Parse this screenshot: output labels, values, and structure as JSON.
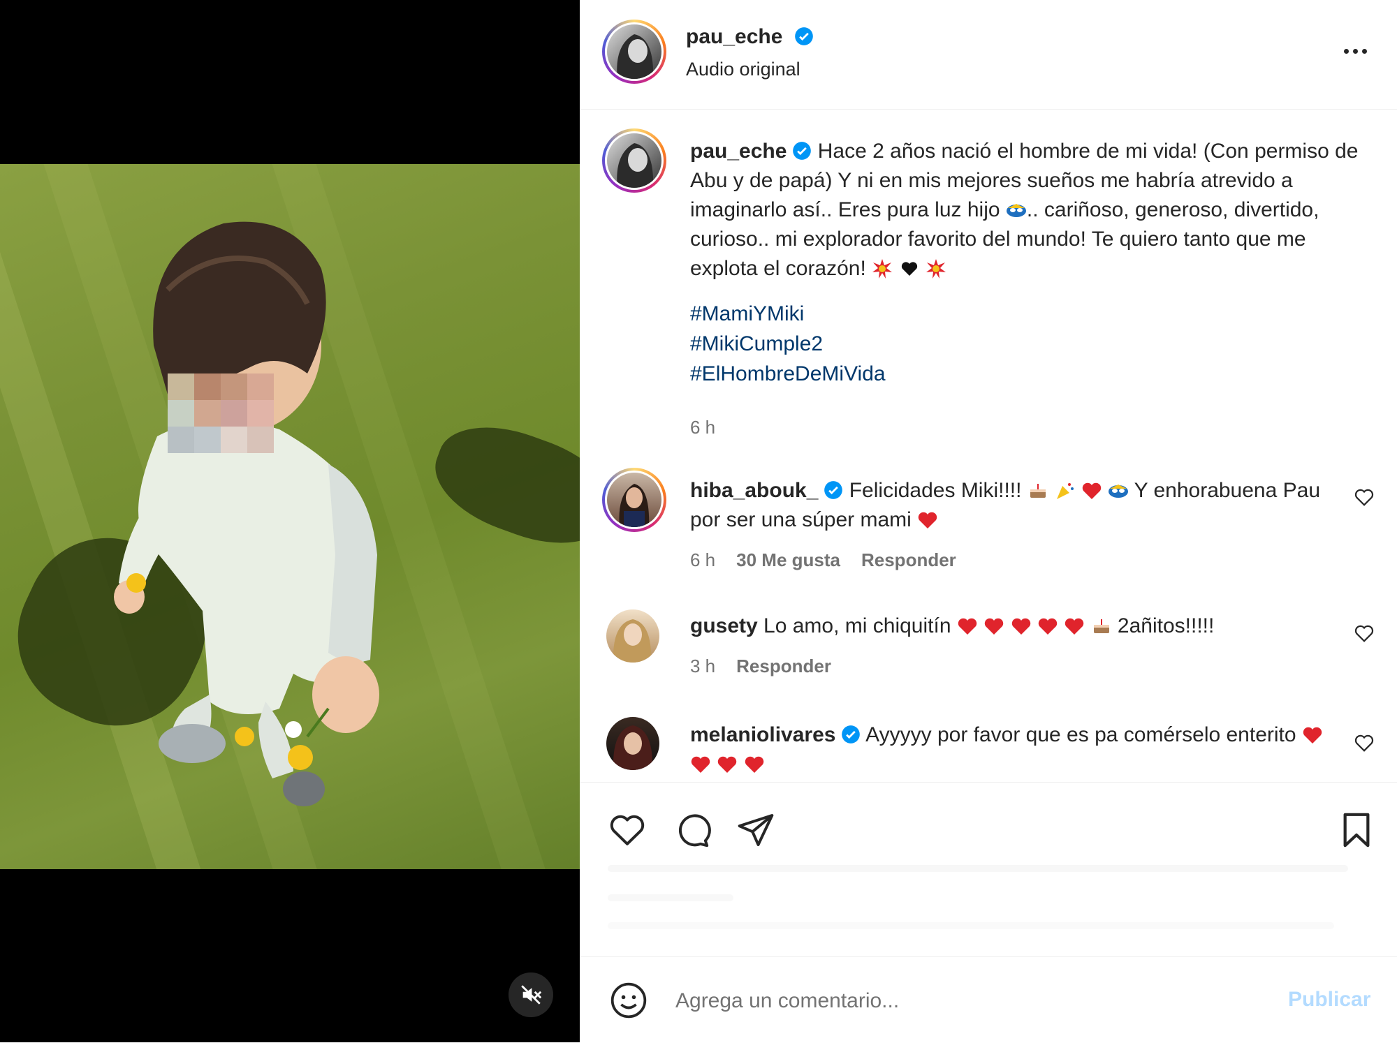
{
  "header": {
    "username": "pau_eche",
    "subtitle": "Audio original",
    "more_icon": "more-horizontal-icon"
  },
  "caption": {
    "username": "pau_eche",
    "text": "Hace 2 años nació el hombre de mi vida! (Con permiso de Abu y de papá) Y ni en mis mejores sueños me habría atrevido a imaginarlo así.. Eres pura luz hijo",
    "text2": ".. cariñoso, generoso, divertido, curioso.. mi explorador favorito del mundo! Te quiero tanto que me explota el corazón!",
    "hashtags": [
      "#MamiYMiki",
      "#MikiCumple2",
      "#ElHombreDeMiVida"
    ],
    "time": "6 h"
  },
  "comments": [
    {
      "username": "hiba_abouk_",
      "text": "Felicidades Miki!!!!",
      "text2": "Y enhorabuena Pau por ser una súper mami",
      "time": "6 h",
      "likes": "30 Me gusta",
      "reply": "Responder",
      "verified": true
    },
    {
      "username": "gusety",
      "text": "Lo amo, mi chiquitín",
      "text2": "2añitos!!!!!",
      "time": "3 h",
      "reply": "Responder",
      "verified": false
    },
    {
      "username": "melaniolivares",
      "text": "Ayyyyy por favor que es pa comérselo enterito",
      "verified": true
    }
  ],
  "composer": {
    "placeholder": "Agrega un comentario...",
    "publish": "Publicar"
  },
  "colors": {
    "link": "#00376b",
    "verified": "#0095f6",
    "publish_disabled": "#b3dbff",
    "heart": "#e0242c"
  }
}
